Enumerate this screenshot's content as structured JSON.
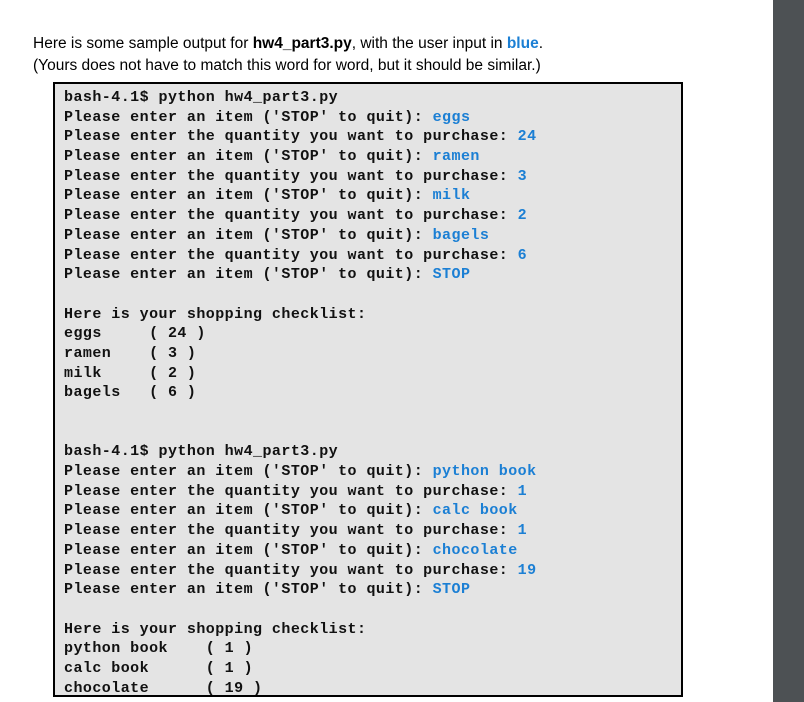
{
  "page": {
    "background_color": "#ffffff",
    "right_band_color": "#4d5154"
  },
  "intro": {
    "line1_part1": "Here is some sample output for ",
    "line1_filename": "hw4_part3.py",
    "line1_part2": ", with the user input in ",
    "line1_blue_word": "blue",
    "line1_part3": ".",
    "line2": "(Yours does not have to match this word for word, but it should be similar.)"
  },
  "terminal": {
    "background_color": "#e4e4e4",
    "border_color": "#000000",
    "prompt_color": "#111111",
    "user_input_color": "#1b7fd4",
    "prompt": "bash-4.1$ ",
    "command": "python hw4_part3.py",
    "item_prompt": "Please enter an item ('STOP' to quit): ",
    "quantity_prompt": "Please enter the quantity you want to purchase: ",
    "checklist_header": "Here is your shopping checklist:",
    "sessions": [
      {
        "command_line": "bash-4.1$ python hw4_part3.py",
        "exchanges": [
          {
            "prompt": "Please enter an item ('STOP' to quit): ",
            "input": "eggs"
          },
          {
            "prompt": "Please enter the quantity you want to purchase: ",
            "input": "24"
          },
          {
            "prompt": "Please enter an item ('STOP' to quit): ",
            "input": "ramen"
          },
          {
            "prompt": "Please enter the quantity you want to purchase: ",
            "input": "3"
          },
          {
            "prompt": "Please enter an item ('STOP' to quit): ",
            "input": "milk"
          },
          {
            "prompt": "Please enter the quantity you want to purchase: ",
            "input": "2"
          },
          {
            "prompt": "Please enter an item ('STOP' to quit): ",
            "input": "bagels"
          },
          {
            "prompt": "Please enter the quantity you want to purchase: ",
            "input": "6"
          },
          {
            "prompt": "Please enter an item ('STOP' to quit): ",
            "input": "STOP"
          }
        ],
        "checklist_header": "Here is your shopping checklist:",
        "checklist": [
          {
            "item": "eggs",
            "qty": "24",
            "line": "eggs     ( 24 )"
          },
          {
            "item": "ramen",
            "qty": "3",
            "line": "ramen    ( 3 )"
          },
          {
            "item": "milk",
            "qty": "2",
            "line": "milk     ( 2 )"
          },
          {
            "item": "bagels",
            "qty": "6",
            "line": "bagels   ( 6 )"
          }
        ]
      },
      {
        "command_line": "bash-4.1$ python hw4_part3.py",
        "exchanges": [
          {
            "prompt": "Please enter an item ('STOP' to quit): ",
            "input": "python book"
          },
          {
            "prompt": "Please enter the quantity you want to purchase: ",
            "input": "1"
          },
          {
            "prompt": "Please enter an item ('STOP' to quit): ",
            "input": "calc book"
          },
          {
            "prompt": "Please enter the quantity you want to purchase: ",
            "input": "1"
          },
          {
            "prompt": "Please enter an item ('STOP' to quit): ",
            "input": "chocolate"
          },
          {
            "prompt": "Please enter the quantity you want to purchase: ",
            "input": "19"
          },
          {
            "prompt": "Please enter an item ('STOP' to quit): ",
            "input": "STOP"
          }
        ],
        "checklist_header": "Here is your shopping checklist:",
        "checklist": [
          {
            "item": "python book",
            "qty": "1",
            "line": "python book    ( 1 )"
          },
          {
            "item": "calc book",
            "qty": "1",
            "line": "calc book      ( 1 )"
          },
          {
            "item": "chocolate",
            "qty": "19",
            "line": "chocolate      ( 19 )"
          }
        ]
      }
    ]
  }
}
